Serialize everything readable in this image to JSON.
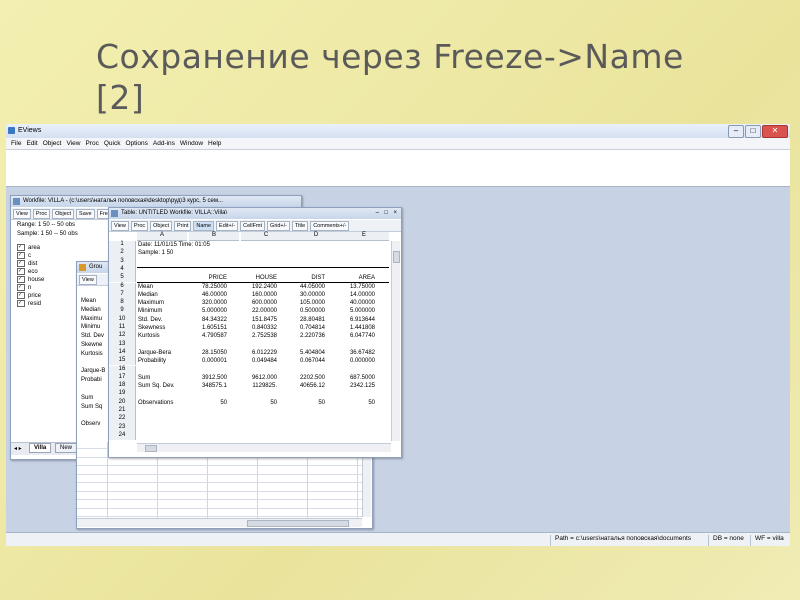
{
  "slide": {
    "title_line1": "Сохранение через Freeze->Name",
    "title_line2": "[2]"
  },
  "app": {
    "title": "EViews",
    "menu": [
      "File",
      "Edit",
      "Object",
      "View",
      "Proc",
      "Quick",
      "Options",
      "Add-ins",
      "Window",
      "Help"
    ],
    "status": {
      "path": "Path = c:\\users\\наталья поповская\\documents",
      "db": "DB = none",
      "wf": "WF = villa"
    }
  },
  "workfile": {
    "title": "Workfile: VILLA - (c:\\users\\наталья поповская\\desktop\\руд\\3 курс, 5 сем...",
    "buttons": [
      "View",
      "Proc",
      "Object",
      "Save",
      "Fre"
    ],
    "range": "Range:  1 50  --  50 obs",
    "sample": "Sample: 1 50  --  50 obs",
    "items": [
      "area",
      "c",
      "dist",
      "eco",
      "house",
      "n",
      "price",
      "resid"
    ],
    "tabs": [
      "Villa",
      "New"
    ]
  },
  "group": {
    "title": "Grou",
    "buttons": [
      "View"
    ],
    "labels": [
      "Mean",
      "Median",
      "Maximu",
      "Minimu",
      "Std. Dev",
      "Skewne",
      "Kurtosis",
      "",
      "Jarque-B",
      "Probabi",
      "",
      "Sum",
      "Sum Sq",
      "",
      "Observ"
    ]
  },
  "table": {
    "title": "Table: UNTITLED   Workfile: VILLA::Villa\\",
    "buttons": [
      "View",
      "Proc",
      "Object",
      "Print",
      "Name",
      "Edit+/-",
      "CellFmt",
      "Grid+/-",
      "Title",
      "Comments+/-"
    ],
    "active_button": "Name",
    "columns": [
      "A",
      "B",
      "C",
      "D",
      "E"
    ],
    "row_numbers": [
      "1",
      "2",
      "3",
      "4",
      "5",
      "6",
      "7",
      "8",
      "9",
      "10",
      "11",
      "12",
      "13",
      "14",
      "15",
      "16",
      "17",
      "18",
      "19",
      "20",
      "21",
      "22",
      "23",
      "24"
    ],
    "date_line": "Date: 11/01/15   Time: 01:05",
    "sample_line": "Sample: 1 50",
    "headers": [
      "PRICE",
      "HOUSE",
      "DIST",
      "AREA"
    ],
    "rows": [
      {
        "label": "Mean",
        "vals": [
          "78.25000",
          "192.2400",
          "44.05000",
          "13.75000"
        ]
      },
      {
        "label": "Median",
        "vals": [
          "46.00000",
          "160.0000",
          "30.00000",
          "14.00000"
        ]
      },
      {
        "label": "Maximum",
        "vals": [
          "320.0000",
          "600.0000",
          "105.0000",
          "40.00000"
        ]
      },
      {
        "label": "Minimum",
        "vals": [
          "5.000000",
          "22.00000",
          "0.500000",
          "5.000000"
        ]
      },
      {
        "label": "Std. Dev.",
        "vals": [
          "84.34322",
          "151.8475",
          "28.80481",
          "6.913644"
        ]
      },
      {
        "label": "Skewness",
        "vals": [
          "1.605151",
          "0.840332",
          "0.704814",
          "1.441808"
        ]
      },
      {
        "label": "Kurtosis",
        "vals": [
          "4.790587",
          "2.752538",
          "2.220736",
          "6.047740"
        ]
      },
      {
        "label": "Jarque-Bera",
        "vals": [
          "28.15050",
          "6.012229",
          "5.404804",
          "36.67482"
        ]
      },
      {
        "label": "Probability",
        "vals": [
          "0.000001",
          "0.049484",
          "0.067044",
          "0.000000"
        ]
      },
      {
        "label": "Sum",
        "vals": [
          "3912.500",
          "9612.000",
          "2202.500",
          "687.5000"
        ]
      },
      {
        "label": "Sum Sq. Dev.",
        "vals": [
          "348575.1",
          "1129825.",
          "40656.12",
          "2342.125"
        ]
      },
      {
        "label": "Observations",
        "vals": [
          "50",
          "50",
          "50",
          "50"
        ]
      }
    ]
  }
}
